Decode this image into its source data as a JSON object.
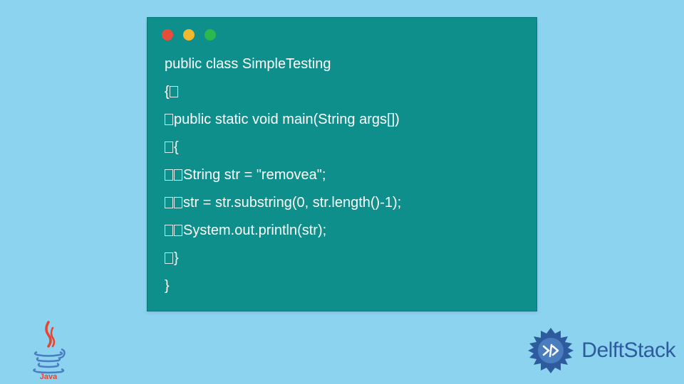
{
  "code": {
    "line1": "public class SimpleTesting",
    "line2": "{",
    "line3": "public static void main(String args[])",
    "line4": "{",
    "line5": "String str = \"removea\";",
    "line6": "str = str.substring(0, str.length()-1);",
    "line7": "System.out.println(str);",
    "line8": "}",
    "line9": "}"
  },
  "branding": {
    "delft_label": "DelftStack"
  }
}
